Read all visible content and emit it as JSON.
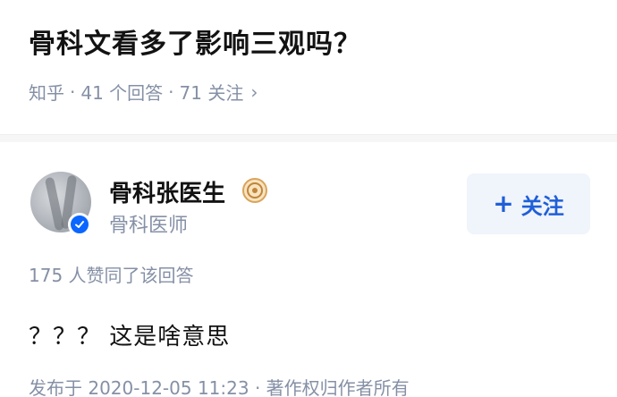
{
  "question": {
    "title": "骨科文看多了影响三观吗？",
    "source": "知乎",
    "sep1": "·",
    "answers_count": "41 个回答",
    "sep2": "·",
    "followers_count": "71 关注",
    "chevron": "›"
  },
  "author": {
    "name": "骨科张医生",
    "bio": "骨科医师",
    "follow_label": "关注",
    "follow_plus": "+",
    "verified_color": "#0a66ff",
    "badge_icon": "gold-medal-icon"
  },
  "answer": {
    "upvotes": "175 人赞同了该回答",
    "content": "？？？ 这是啥意思",
    "footer": "发布于 2020-12-05 11:23 · 著作权归作者所有"
  },
  "colors": {
    "accent": "#1f5fd8",
    "muted": "#8590a6",
    "follow_bg": "#f0f4fb"
  }
}
